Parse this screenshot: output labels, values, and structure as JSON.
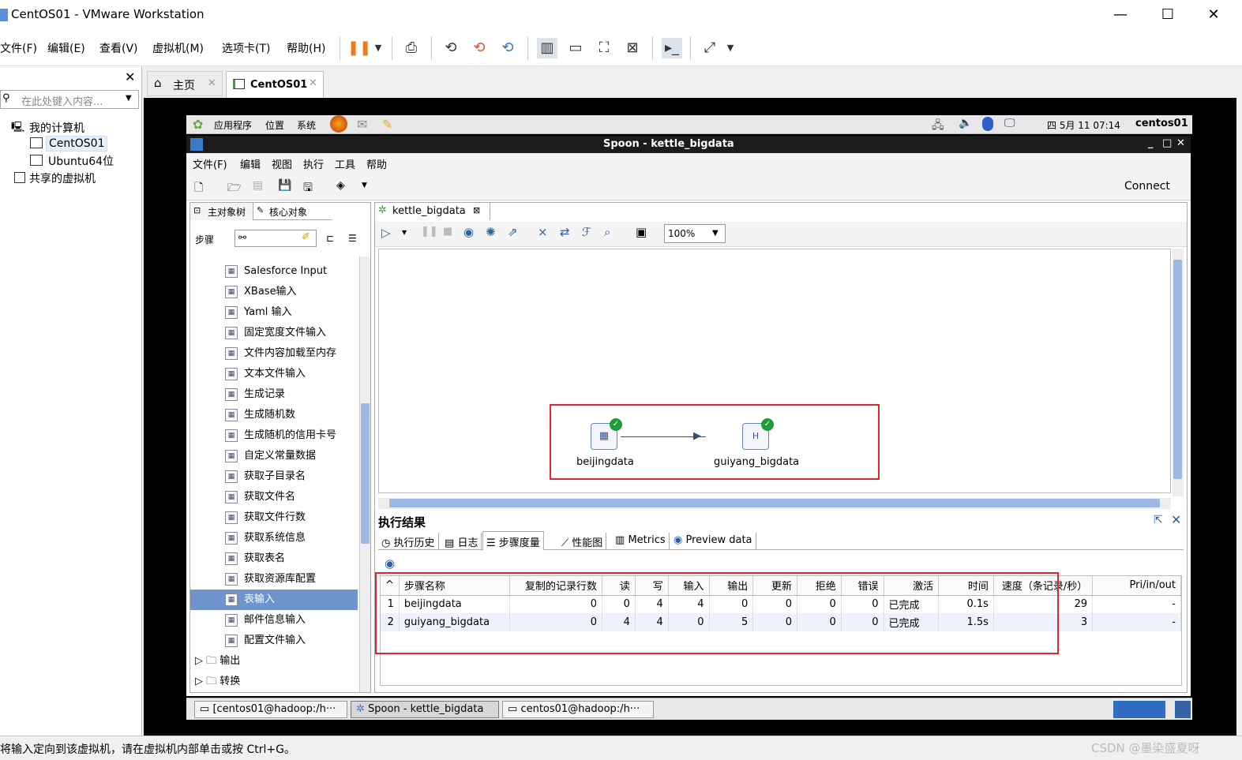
{
  "window": {
    "title": "CentOS01 - VMware Workstation"
  },
  "menu": [
    "文件(F)",
    "编辑(E)",
    "查看(V)",
    "虚拟机(M)",
    "选项卡(T)",
    "帮助(H)"
  ],
  "library": {
    "search_placeholder": "在此处键入内容...",
    "my_computer": "我的计算机",
    "vm1": "CentOS01",
    "vm2": "Ubuntu64位",
    "shared": "共享的虚拟机"
  },
  "tabs": {
    "home": "主页",
    "vm": "CentOS01"
  },
  "gnome": {
    "apps": "应用程序",
    "places": "位置",
    "system": "系统",
    "clock": "四 5月 11 07:14",
    "host": "centos01"
  },
  "spoon": {
    "title": "Spoon - kettle_bigdata",
    "menu": [
      "文件(F)",
      "编辑",
      "视图",
      "执行",
      "工具",
      "帮助"
    ],
    "connect": "Connect",
    "left_tabs": {
      "main": "主对象树",
      "core": "核心对象"
    },
    "steps_label": "步骤",
    "tree": [
      "Salesforce Input",
      "XBase输入",
      "Yaml 输入",
      "固定宽度文件输入",
      "文件内容加载至内存",
      "文本文件输入",
      "生成记录",
      "生成随机数",
      "生成随机的信用卡号",
      "自定义常量数据",
      "获取子目录名",
      "获取文件名",
      "获取文件行数",
      "获取系统信息",
      "获取表名",
      "获取资源库配置",
      "表输入",
      "邮件信息输入",
      "配置文件输入"
    ],
    "folders": [
      "输出",
      "转换"
    ],
    "canvas_tab": "kettle_bigdata",
    "zoom": "100%",
    "nodes": {
      "a": "beijingdata",
      "b": "guiyang_bigdata"
    },
    "results_title": "执行结果",
    "result_tabs": [
      "执行历史",
      "日志",
      "步骤度量",
      "性能图",
      "Metrics",
      "Preview data"
    ],
    "columns": [
      "步骤名称",
      "复制的记录行数",
      "读",
      "写",
      "输入",
      "输出",
      "更新",
      "拒绝",
      "错误",
      "激活",
      "时间",
      "速度（条记录/秒）",
      "Pri/in/out"
    ],
    "rows": [
      {
        "n": "1",
        "name": "beijingdata",
        "copy": "0",
        "r": "0",
        "w": "4",
        "in": "4",
        "out": "0",
        "upd": "0",
        "rej": "0",
        "err": "0",
        "act": "已完成",
        "time": "0.1s",
        "speed": "29",
        "pio": "-"
      },
      {
        "n": "2",
        "name": "guiyang_bigdata",
        "copy": "0",
        "r": "4",
        "w": "4",
        "in": "0",
        "out": "5",
        "upd": "0",
        "rej": "0",
        "err": "0",
        "act": "已完成",
        "time": "1.5s",
        "speed": "3",
        "pio": "-"
      }
    ]
  },
  "taskbar": [
    "[centos01@hadoop:/h···",
    "Spoon - kettle_bigdata",
    "centos01@hadoop:/h···"
  ],
  "status": {
    "text": "将输入定向到该虚拟机，请在虚拟机内部单击或按 Ctrl+G。",
    "watermark": "CSDN @墨染盛夏呀"
  }
}
